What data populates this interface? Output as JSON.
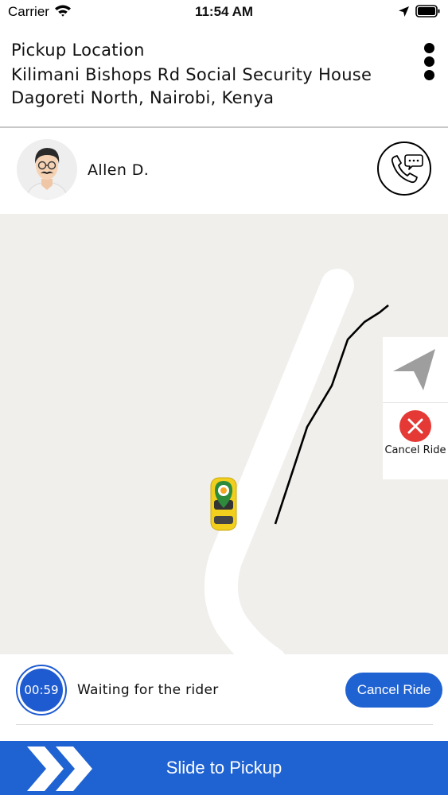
{
  "status_bar": {
    "carrier": "Carrier",
    "time": "11:54 AM"
  },
  "pickup": {
    "title": "Pickup Location",
    "address": "Kilimani Bishops Rd Social Security House Dagoreti North, Nairobi, Kenya"
  },
  "rider": {
    "name": "Allen D."
  },
  "map": {
    "cancel_label": "Cancel Ride"
  },
  "waiting": {
    "timer": "00:59",
    "message": "Waiting for the rider",
    "cancel_button": "Cancel Ride"
  },
  "slide": {
    "label": "Slide to Pickup"
  },
  "colors": {
    "primary_blue": "#1f62d2",
    "cancel_red": "#e53935",
    "map_background": "#f0efec",
    "car_yellow": "#f2cf1c"
  },
  "icons": {
    "wifi": "wifi-icon",
    "location": "location-arrow-icon",
    "battery": "battery-icon",
    "menu": "more-vertical-icon",
    "call": "phone-chat-icon",
    "recenter": "navigation-arrow-icon",
    "cancel": "close-icon",
    "slide": "double-chevron-right-icon"
  }
}
